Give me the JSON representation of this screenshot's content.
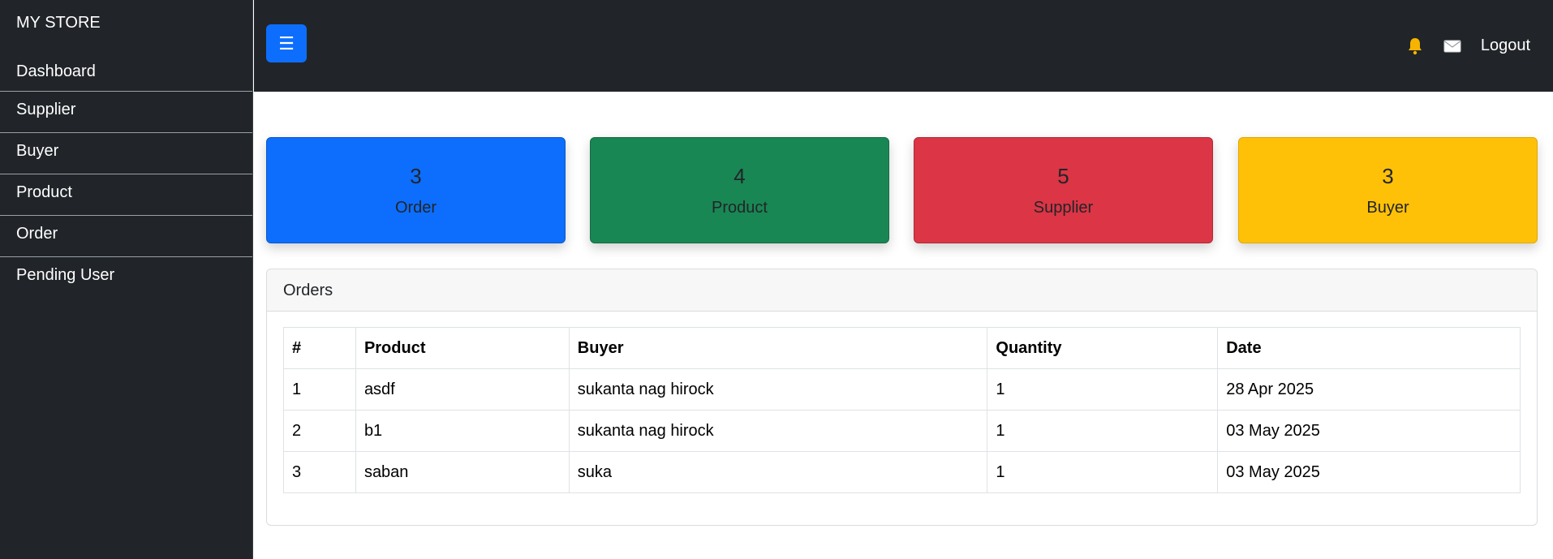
{
  "brand": "MY STORE",
  "sidebar": {
    "items": [
      {
        "label": "Dashboard"
      },
      {
        "label": "Supplier"
      },
      {
        "label": "Buyer"
      },
      {
        "label": "Product"
      },
      {
        "label": "Order"
      },
      {
        "label": "Pending User"
      }
    ]
  },
  "topbar": {
    "toggle_icon": "☰",
    "bell_icon": "bell-icon",
    "mail_icon": "envelope-icon",
    "logout_label": "Logout"
  },
  "stats": [
    {
      "value": "3",
      "label": "Order",
      "color": "#0d6efd"
    },
    {
      "value": "4",
      "label": "Product",
      "color": "#198754"
    },
    {
      "value": "5",
      "label": "Supplier",
      "color": "#dc3545"
    },
    {
      "value": "3",
      "label": "Buyer",
      "color": "#ffc107"
    }
  ],
  "orders": {
    "title": "Orders",
    "columns": [
      "#",
      "Product",
      "Buyer",
      "Quantity",
      "Date"
    ],
    "rows": [
      [
        "1",
        "asdf",
        "sukanta nag hirock",
        "1",
        "28 Apr 2025"
      ],
      [
        "2",
        "b1",
        "sukanta nag hirock",
        "1",
        "03 May 2025"
      ],
      [
        "3",
        "saban",
        "suka",
        "1",
        "03 May 2025"
      ]
    ]
  }
}
